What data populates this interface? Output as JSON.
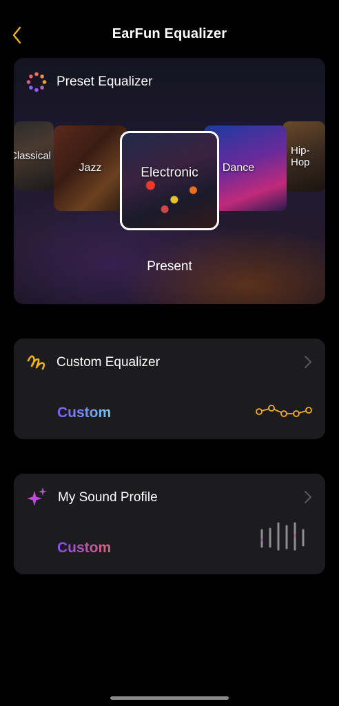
{
  "header": {
    "title": "EarFun Equalizer",
    "back_icon": "chevron-left-icon",
    "accent_color": "#f2b21a"
  },
  "preset": {
    "title": "Preset Equalizer",
    "icon": "dots-ring-icon",
    "tiles": [
      {
        "label": "Classical"
      },
      {
        "label": "Jazz"
      },
      {
        "label": "Electronic"
      },
      {
        "label": "Dance"
      },
      {
        "label": "Hip-Hop"
      }
    ],
    "selected": "Electronic",
    "status": "Present"
  },
  "custom_eq": {
    "title": "Custom Equalizer",
    "icon": "squiggle-icon",
    "value": "Custom",
    "graphic_icon": "eq-curve-icon"
  },
  "sound_profile": {
    "title": "My Sound Profile",
    "icon": "sparkles-icon",
    "value": "Custom",
    "graphic_icon": "waveform-icon"
  }
}
